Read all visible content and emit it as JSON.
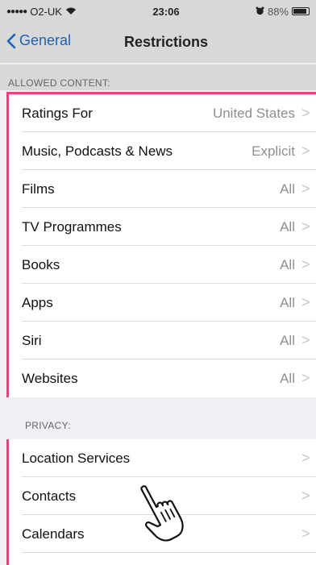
{
  "status_bar": {
    "signal_dots": "●●●●●",
    "carrier": "O2-UK",
    "wifi_icon": "wifi-icon",
    "time": "23:06",
    "alarm_icon": "alarm-icon",
    "battery": "88%"
  },
  "nav": {
    "back_label": "General",
    "title": "Restrictions"
  },
  "sections": {
    "allowed_header": "ALLOWED CONTENT:",
    "privacy_header": "PRIVACY:"
  },
  "allowed_rows": [
    {
      "label": "Ratings For",
      "value": "United States"
    },
    {
      "label": "Music, Podcasts & News",
      "value": "Explicit"
    },
    {
      "label": "Films",
      "value": "All"
    },
    {
      "label": "TV Programmes",
      "value": "All"
    },
    {
      "label": "Books",
      "value": "All"
    },
    {
      "label": "Apps",
      "value": "All"
    },
    {
      "label": "Siri",
      "value": "All"
    },
    {
      "label": "Websites",
      "value": "All"
    }
  ],
  "privacy_rows": [
    {
      "label": "Location Services"
    },
    {
      "label": "Contacts"
    },
    {
      "label": "Calendars"
    }
  ],
  "chevron": ">",
  "colors": {
    "accent": "#1d62b5",
    "highlight_border": "#e0467a"
  }
}
